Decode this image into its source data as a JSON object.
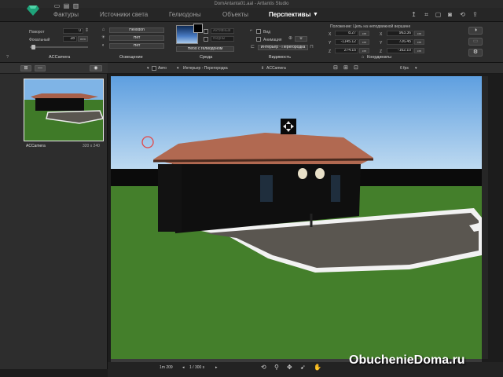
{
  "window": {
    "title": "DomAntanta01.aal - Artlantis Studio"
  },
  "tabs": [
    {
      "label": "Фактуры"
    },
    {
      "label": "Источники света"
    },
    {
      "label": "Гелиодоны"
    },
    {
      "label": "Объекты"
    },
    {
      "label": "Перспективы"
    }
  ],
  "tab_dropdown": "▼",
  "camera": {
    "tilt_label": "Поворот",
    "tilt_value": "0",
    "focal_label": "Фокальный",
    "focal_value": "28",
    "focal_unit": "mm",
    "section_label": "ACCamera"
  },
  "lighting": {
    "heliodon": "Heliodon",
    "light1": "Нет",
    "light2": "Нет",
    "section_label": "Освещение"
  },
  "environment": {
    "btn1": "Активный",
    "btn2": "Видны",
    "sky": "Небо с гелиодоном",
    "section_label": "Среда"
  },
  "visibility": {
    "view_label": "Вид",
    "anim_label": "Анимация",
    "anim_value": "0",
    "inter": "Интерьер - Перегородка",
    "section_label": "Видимость"
  },
  "coords": {
    "header": "Положение: Цель на неподвижной вершине",
    "pos": {
      "x": "8.27",
      "y": "-1145.12",
      "z": "274.15"
    },
    "target": {
      "x": "963.36",
      "y": "726.45",
      "z": "-162.10"
    },
    "unit": "cm",
    "axes": [
      "X",
      "Y",
      "Z"
    ],
    "section_label": "Координаты"
  },
  "left_panel": {
    "minus_btn": "—",
    "thumb_name": "ACCamera",
    "thumb_size": "320 x 240"
  },
  "viewport_toolbar": {
    "auto": "Авто",
    "inter": "Интерьер - Перегородка",
    "camera": "ACCamera",
    "fps": "6 fps"
  },
  "bottom": {
    "scale": "1m 209",
    "page": "1 / 300 s"
  },
  "watermark": "ObuchenieDoma.ru",
  "colors": {
    "accent": "#1fa37a",
    "sky": "#6ea8dd",
    "grass": "#3f7a28",
    "roof": "#a8604a",
    "path": "#5a5650"
  },
  "icons": [
    "logo-icon",
    "light-icon",
    "heliodon-icon",
    "camera-icon",
    "settings-icon",
    "eye-icon",
    "navigate-icon",
    "refresh-icon"
  ]
}
